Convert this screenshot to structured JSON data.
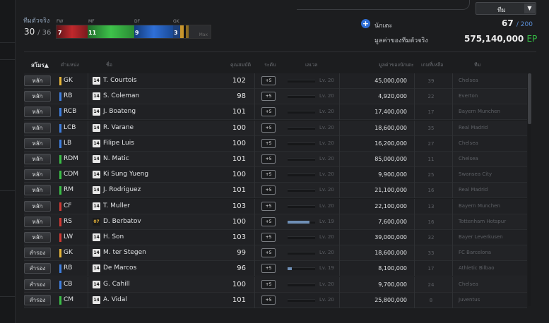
{
  "header": {
    "team_dropdown": "ทีม",
    "real_team_label": "ทีมตัวจริง",
    "starters_count": "30",
    "starters_total": "/ 36",
    "formation_labels": [
      "FW",
      "MF",
      "DF",
      "GK"
    ],
    "formation_values": [
      "7",
      "11",
      "9",
      "3"
    ],
    "formation_max": "Max",
    "player_label": "นักเตะ",
    "player_count": "67",
    "player_total": "/ 200",
    "value_label": "มูลค่าของทีมตัวจริง",
    "value_amount": "575,140,000",
    "value_unit": "EP"
  },
  "columns": {
    "status": "สโมร▲",
    "position": "ตำแหน่ง",
    "name": "ชื่อ",
    "ovr": "คุณสมบัติ",
    "upgrade": "ระดับ",
    "level": "เลเวล",
    "price": "มูลค่าของนักเตะ",
    "games": "เกมที่เหลือ",
    "club": "ทีม"
  },
  "colors": {
    "GK": "#e7b63a",
    "DF": "#3f7fe0",
    "MF": "#3bbf47",
    "FW": "#d23a34"
  },
  "players": [
    {
      "status": "หลัก",
      "pos": "GK",
      "line": "GK",
      "badge": "14",
      "name": "T. Courtois",
      "ovr": "102",
      "up": "+5",
      "exp": 0,
      "lv": "Lv. 20",
      "price": "45,000,000",
      "games": "39",
      "club": "Chelsea"
    },
    {
      "status": "หลัก",
      "pos": "RB",
      "line": "DF",
      "badge": "14",
      "name": "S. Coleman",
      "ovr": "98",
      "up": "+5",
      "exp": 0,
      "lv": "Lv. 20",
      "price": "4,920,000",
      "games": "22",
      "club": "Everton"
    },
    {
      "status": "หลัก",
      "pos": "RCB",
      "line": "DF",
      "badge": "14",
      "name": "J. Boateng",
      "ovr": "101",
      "up": "+5",
      "exp": 0,
      "lv": "Lv. 20",
      "price": "17,400,000",
      "games": "17",
      "club": "Bayern Munchen"
    },
    {
      "status": "หลัก",
      "pos": "LCB",
      "line": "DF",
      "badge": "14",
      "name": "R. Varane",
      "ovr": "100",
      "up": "+5",
      "exp": 0,
      "lv": "Lv. 20",
      "price": "18,600,000",
      "games": "35",
      "club": "Real Madrid"
    },
    {
      "status": "หลัก",
      "pos": "LB",
      "line": "DF",
      "badge": "14",
      "name": "Filipe Luis",
      "ovr": "100",
      "up": "+5",
      "exp": 0,
      "lv": "Lv. 20",
      "price": "16,200,000",
      "games": "27",
      "club": "Chelsea"
    },
    {
      "status": "หลัก",
      "pos": "RDM",
      "line": "MF",
      "badge": "14",
      "name": "N. Matic",
      "ovr": "101",
      "up": "+5",
      "exp": 0,
      "lv": "Lv. 20",
      "price": "85,000,000",
      "games": "11",
      "club": "Chelsea"
    },
    {
      "status": "หลัก",
      "pos": "CDM",
      "line": "MF",
      "badge": "14",
      "name": "Ki Sung Yueng",
      "ovr": "100",
      "up": "+5",
      "exp": 0,
      "lv": "Lv. 20",
      "price": "9,900,000",
      "games": "25",
      "club": "Swansea City"
    },
    {
      "status": "หลัก",
      "pos": "RM",
      "line": "MF",
      "badge": "14",
      "name": "J. Rodriguez",
      "ovr": "101",
      "up": "+5",
      "exp": 0,
      "lv": "Lv. 20",
      "price": "21,100,000",
      "games": "16",
      "club": "Real Madrid"
    },
    {
      "status": "หลัก",
      "pos": "CF",
      "line": "FW",
      "badge": "14",
      "name": "T. Muller",
      "ovr": "103",
      "up": "+5",
      "exp": 0,
      "lv": "Lv. 20",
      "price": "22,100,000",
      "games": "13",
      "club": "Bayern Munchen"
    },
    {
      "status": "หลัก",
      "pos": "RS",
      "line": "FW",
      "badge": "07",
      "gold": true,
      "name": "D. Berbatov",
      "ovr": "100",
      "up": "+5",
      "exp": 0.8,
      "lv": "Lv. 19",
      "price": "7,600,000",
      "games": "16",
      "club": "Tottenham Hotspur"
    },
    {
      "status": "หลัก",
      "pos": "LW",
      "line": "FW",
      "badge": "14",
      "name": "H. Son",
      "ovr": "103",
      "up": "+5",
      "exp": 0,
      "lv": "Lv. 20",
      "price": "39,000,000",
      "games": "32",
      "club": "Bayer Leverkusen"
    },
    {
      "status": "สำรอง",
      "pos": "GK",
      "line": "GK",
      "badge": "14",
      "name": "M. ter Stegen",
      "ovr": "99",
      "up": "+5",
      "exp": 0,
      "lv": "Lv. 20",
      "price": "18,600,000",
      "games": "33",
      "club": "FC Barcelona"
    },
    {
      "status": "สำรอง",
      "pos": "RB",
      "line": "DF",
      "badge": "14",
      "name": "De Marcos",
      "ovr": "96",
      "up": "+5",
      "exp": 0.15,
      "lv": "Lv. 19",
      "price": "8,100,000",
      "games": "17",
      "club": "Athletic Bilbao"
    },
    {
      "status": "สำรอง",
      "pos": "CB",
      "line": "DF",
      "badge": "14",
      "name": "G. Cahill",
      "ovr": "100",
      "up": "+5",
      "exp": 0,
      "lv": "Lv. 20",
      "price": "9,700,000",
      "games": "24",
      "club": "Chelsea"
    },
    {
      "status": "สำรอง",
      "pos": "CM",
      "line": "MF",
      "badge": "14",
      "name": "A. Vidal",
      "ovr": "101",
      "up": "+5",
      "exp": 0,
      "lv": "Lv. 20",
      "price": "25,800,000",
      "games": "8",
      "club": "Juventus"
    }
  ]
}
